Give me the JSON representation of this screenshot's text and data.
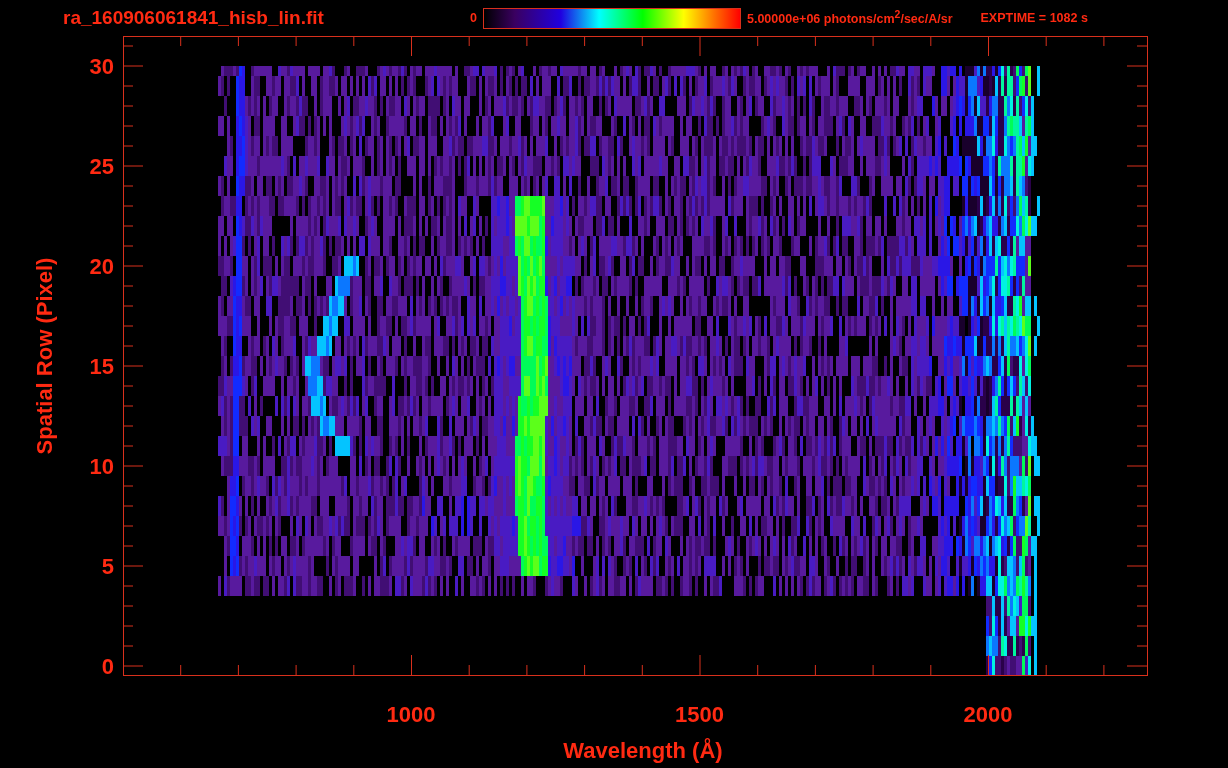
{
  "header": {
    "title": "ra_160906061841_hisb_lin.fit",
    "colorbar": {
      "min_label": "0",
      "max_label": "5.00000e+06 photons/cm$^{2}$/sec/A/sr"
    },
    "exposure": "EXPTIME = 1082 s"
  },
  "plot": {
    "xlabel": "Wavelength (Å)",
    "ylabel": "Spatial Row (Pixel)",
    "xticks": [
      "1000",
      "1500",
      "2000"
    ],
    "yticks": [
      "30",
      "25",
      "20",
      "15",
      "10",
      "5",
      "0"
    ]
  }
}
